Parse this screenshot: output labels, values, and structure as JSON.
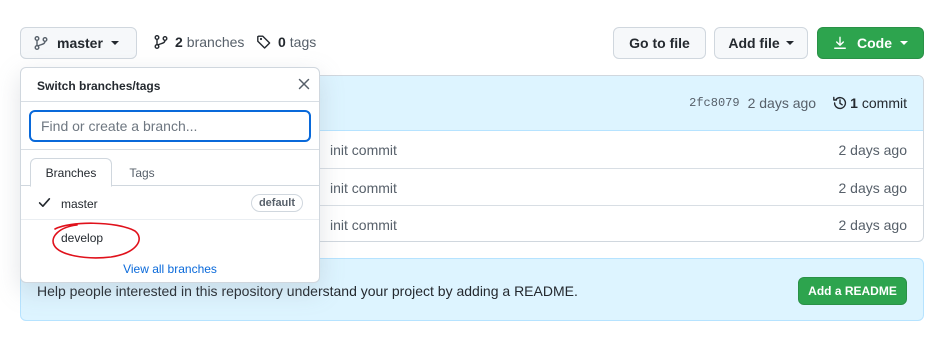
{
  "toolbar": {
    "branch_label": "master",
    "branches_count": "2",
    "branches_label": "branches",
    "tags_count": "0",
    "tags_label": "tags",
    "goto_file_label": "Go to file",
    "add_file_label": "Add file",
    "code_label": "Code"
  },
  "commit_header": {
    "sha": "2fc8079",
    "time": "2 days ago",
    "commit_count": "1",
    "commit_label": "commit"
  },
  "files": [
    {
      "message": "init commit",
      "age": "2 days ago"
    },
    {
      "message": "init commit",
      "age": "2 days ago"
    },
    {
      "message": "init commit",
      "age": "2 days ago"
    }
  ],
  "readme_banner": {
    "text": "Help people interested in this repository understand your project by adding a README.",
    "button_label": "Add a README"
  },
  "branch_dropdown": {
    "title": "Switch branches/tags",
    "filter_placeholder": "Find or create a branch...",
    "filter_value": "",
    "tabs": [
      {
        "label": "Branches",
        "active": true
      },
      {
        "label": "Tags",
        "active": false
      }
    ],
    "branches": [
      {
        "name": "master",
        "selected": true,
        "badge": "default"
      },
      {
        "name": "develop",
        "selected": false,
        "badge": ""
      }
    ],
    "view_all_label": "View all branches"
  },
  "colors": {
    "primary_green": "#2da44e",
    "link_blue": "#0969da",
    "banner_blue": "#ddf4ff",
    "annotation_red": "#e0111b"
  },
  "icons": {
    "branch": "git-branch-icon",
    "tag": "tag-icon",
    "download": "download-icon",
    "history": "history-icon",
    "check": "check-icon",
    "close": "close-icon"
  }
}
